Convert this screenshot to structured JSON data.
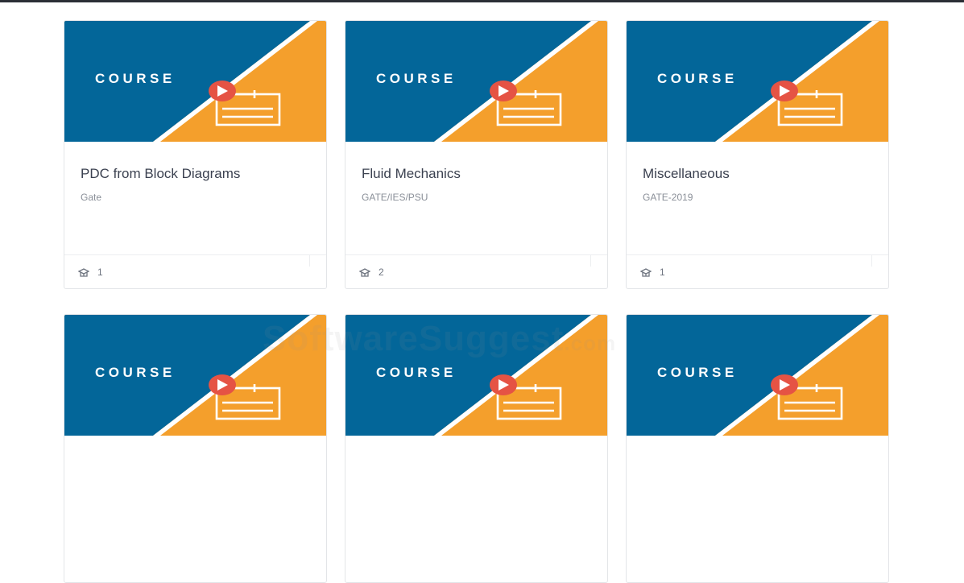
{
  "thumbnail": {
    "label": "COURSE",
    "colors": {
      "blue": "#036699",
      "orange": "#f49f2c",
      "play": "#e55344",
      "stripe": "#ffffff"
    }
  },
  "courses": [
    {
      "title": "PDC from Block Diagrams",
      "category": "Gate",
      "lessons": "1",
      "icon": "lesson-icon"
    },
    {
      "title": "Fluid Mechanics",
      "category": "GATE/IES/PSU",
      "lessons": "2",
      "icon": "lesson-icon"
    },
    {
      "title": "Miscellaneous",
      "category": "GATE-2019",
      "lessons": "1",
      "icon": "lesson-icon"
    },
    {
      "title": "",
      "category": "",
      "lessons": ""
    },
    {
      "title": "",
      "category": "",
      "lessons": ""
    },
    {
      "title": "",
      "category": "",
      "lessons": ""
    }
  ],
  "watermark": {
    "text": "SoftwareSuggest",
    "suffix": ".com"
  }
}
